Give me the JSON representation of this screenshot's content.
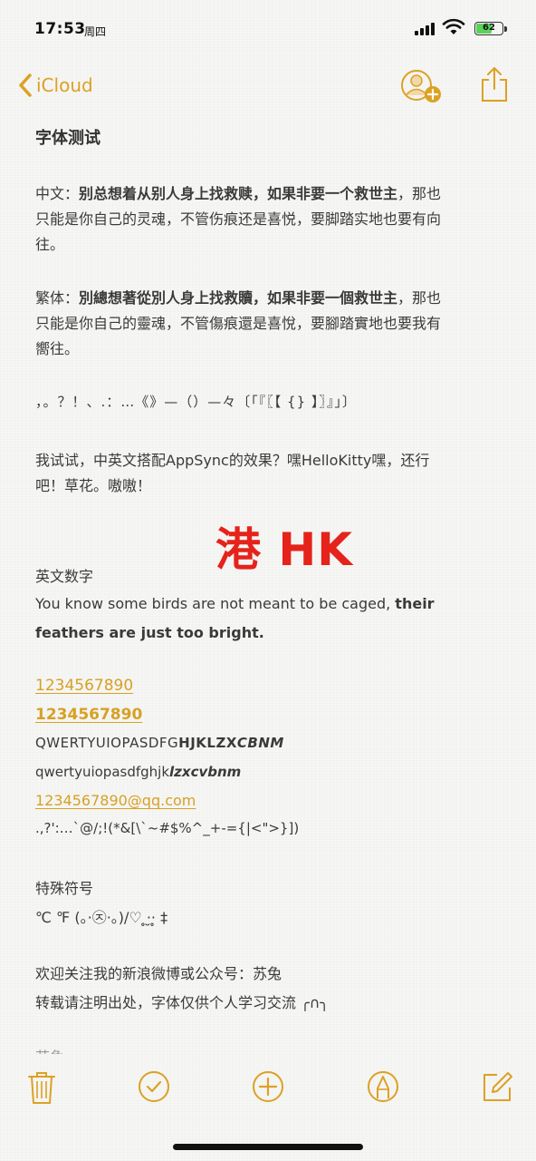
{
  "status_bar": {
    "time": "17:53",
    "day": "周四",
    "battery": "62",
    "battery_level": 0.62
  },
  "nav": {
    "back_label": "iCloud"
  },
  "note": {
    "title": "字体测试",
    "simplified": {
      "prefix": "中文：",
      "bold": "别总想着从别人身上找救赎，如果非要一个救世主",
      "rest_line1": "，那也",
      "line2": "只能是你自己的灵魂，不管伤痕还是喜悦，要脚踏实地也要有向",
      "line3": "往。"
    },
    "traditional": {
      "prefix": "繁体：",
      "bold": "別總想著從別人身上找救贖，如果非要一個救世主",
      "rest_line1": "，那也",
      "line2": "只能是你自己的靈魂，不管傷痕還是喜悅，要腳踏實地也要我有",
      "line3": "嚮往。"
    },
    "punctuation": "，。？！、.：…《》—（）—々〔「『〖【 {} 】〗』」〕",
    "mixed_line1": "我试试，中英文搭配AppSync的效果？嘿HelloKitty嘿，还行",
    "mixed_line2": "吧！草花。嗷嗷！",
    "hk_badge": "港 HK",
    "english_heading": "英文数字",
    "english_line1_plain": "You know some birds are not meant to be caged, ",
    "english_line1_bold": "their",
    "english_line2_bold": "feathers are just too bright.",
    "digits_link": "1234567890",
    "digits_link_bold": "1234567890",
    "upper_plain": "QWERTYUIOPASDFG",
    "upper_bold": "HJKLZX",
    "upper_bold_italic": "CBNM",
    "lower_plain": "qwertyuiopasdfghjk",
    "lower_bold_italic": "lzxcvbnm",
    "email_link": "1234567890@qq.com",
    "symbols": ".,?':…`@/;!(*&[\\`~#$%^_+-={|<\">}])",
    "special_heading": "特殊符号",
    "special_symbols": "℃  ℉ (。·㉨·。)/♡  ̥·̮·̥ ‡",
    "follow_line": "欢迎关注我的新浪微博或公众号：苏兔",
    "copyright_line": "转载请注明出处，字体仅供个人学习交流 ╭∩╮",
    "cut_line": "苏兔"
  },
  "toolbar": {
    "items": [
      "delete",
      "checklist",
      "add",
      "markup",
      "compose"
    ]
  },
  "colors": {
    "accent": "#dca124",
    "hk_red": "#e5231b"
  }
}
